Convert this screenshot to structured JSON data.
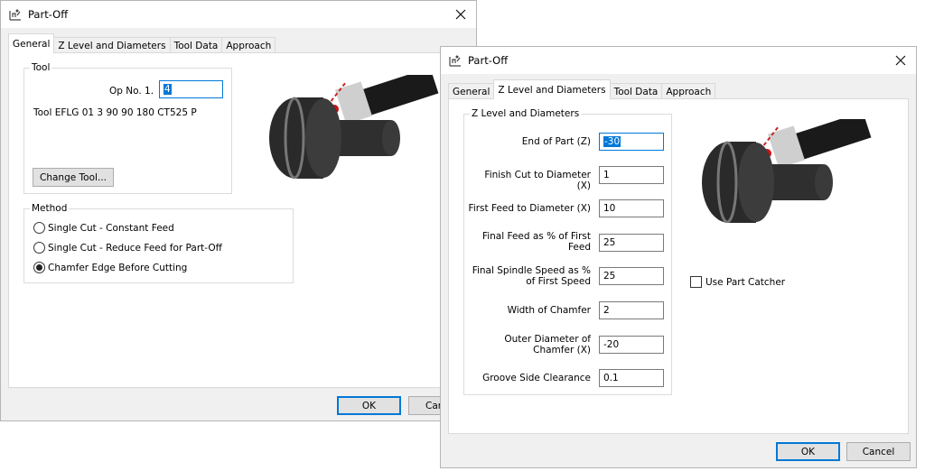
{
  "back_dialog": {
    "title": "Part-Off",
    "tabs": [
      "General",
      "Z Level and Diameters",
      "Tool Data",
      "Approach"
    ],
    "active_tab": "General",
    "tool_group": {
      "legend": "Tool",
      "op_label": "Op No.  1.",
      "op_value": "4",
      "tool_text": "Tool EFLG 01 3 90 90 180 CT525 P",
      "change_tool_label": "Change Tool..."
    },
    "method_group": {
      "legend": "Method",
      "options": [
        {
          "label": "Single Cut - Constant Feed",
          "selected": false
        },
        {
          "label": "Single Cut - Reduce Feed for Part-Off",
          "selected": false
        },
        {
          "label": "Chamfer Edge Before Cutting",
          "selected": true
        }
      ]
    },
    "ok_label": "OK",
    "cancel_label": "Canc"
  },
  "front_dialog": {
    "title": "Part-Off",
    "tabs": [
      "General",
      "Z Level and Diameters",
      "Tool Data",
      "Approach"
    ],
    "active_tab": "Z Level and Diameters",
    "group_legend": "Z Level and Diameters",
    "fields": [
      {
        "label": "End of Part (Z)",
        "value": "-30"
      },
      {
        "label": "Finish Cut to Diameter (X)",
        "value": "1"
      },
      {
        "label": "First Feed to Diameter (X)",
        "value": "10"
      },
      {
        "label": "Final Feed as % of First Feed",
        "value": "25"
      },
      {
        "label": "Final Spindle Speed as % of First Speed",
        "value": "25"
      },
      {
        "label": "Width of Chamfer",
        "value": "2"
      },
      {
        "label": "Outer Diameter of Chamfer (X)",
        "value": "-20"
      },
      {
        "label": "Groove Side Clearance",
        "value": "0.1"
      }
    ],
    "use_part_catcher_label": "Use Part Catcher",
    "use_part_catcher_checked": false,
    "ok_label": "OK",
    "cancel_label": "Cancel"
  },
  "colors": {
    "accent": "#0078d7",
    "dialog_bg": "#f0f0f0",
    "panel_bg": "#ffffff"
  }
}
